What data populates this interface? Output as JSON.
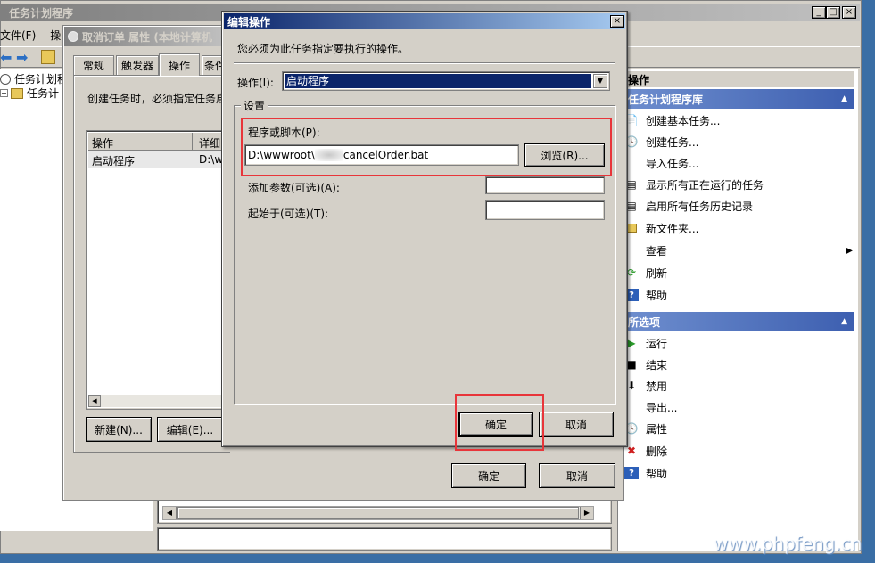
{
  "main_window": {
    "title": "任务计划程序",
    "menu": [
      "文件(F)",
      "操"
    ],
    "tree": [
      "任务计划程",
      "任务计"
    ]
  },
  "props_window": {
    "title": "取消订单 属性 (本地计算机",
    "tabs": [
      "常规",
      "触发器",
      "操作",
      "条件"
    ],
    "description": "创建任务时，必须指定任务启",
    "table_headers": [
      "操作",
      "详细"
    ],
    "table_row": [
      "启动程序",
      "D:\\w"
    ],
    "new_button": "新建(N)...",
    "edit_button": "编辑(E)...",
    "ok_button": "确定",
    "cancel_button": "取消"
  },
  "dialog": {
    "title": "编辑操作",
    "close_label": "×",
    "instruction": "您必须为此任务指定要执行的操作。",
    "action_label": "操作(I):",
    "action_value": "启动程序",
    "settings_group": "设置",
    "program_label": "程序或脚本(P):",
    "program_value": "D:\\wwwroot\\",
    "program_value_tail": "cancelOrder.bat",
    "browse_button": "浏览(R)...",
    "args_label": "添加参数(可选)(A):",
    "args_value": "",
    "startin_label": "起始于(可选)(T):",
    "startin_value": "",
    "ok_button": "确定",
    "cancel_button": "取消"
  },
  "actions_pane": {
    "header": "操作",
    "section1_title": "任务计划程序库",
    "section1_items": [
      {
        "label": "创建基本任务...",
        "icon": "create-basic-task-icon"
      },
      {
        "label": "创建任务...",
        "icon": "create-task-icon"
      },
      {
        "label": "导入任务...",
        "icon": "import-icon"
      },
      {
        "label": "显示所有正在运行的任务",
        "icon": "running-tasks-icon"
      },
      {
        "label": "启用所有任务历史记录",
        "icon": "history-icon"
      },
      {
        "label": "新文件夹...",
        "icon": "folder-icon"
      },
      {
        "label": "查看",
        "icon": "view-icon"
      },
      {
        "label": "刷新",
        "icon": "refresh-icon"
      },
      {
        "label": "帮助",
        "icon": "help-icon"
      }
    ],
    "section2_title": "所选项",
    "section2_items": [
      {
        "label": "运行",
        "icon": "run-icon"
      },
      {
        "label": "结束",
        "icon": "stop-icon"
      },
      {
        "label": "禁用",
        "icon": "disable-icon"
      },
      {
        "label": "导出...",
        "icon": "export-icon"
      },
      {
        "label": "属性",
        "icon": "properties-icon"
      },
      {
        "label": "删除",
        "icon": "delete-icon"
      },
      {
        "label": "帮助",
        "icon": "help-icon"
      }
    ]
  },
  "watermark": {
    "text": "www.phpfeng.cn"
  }
}
